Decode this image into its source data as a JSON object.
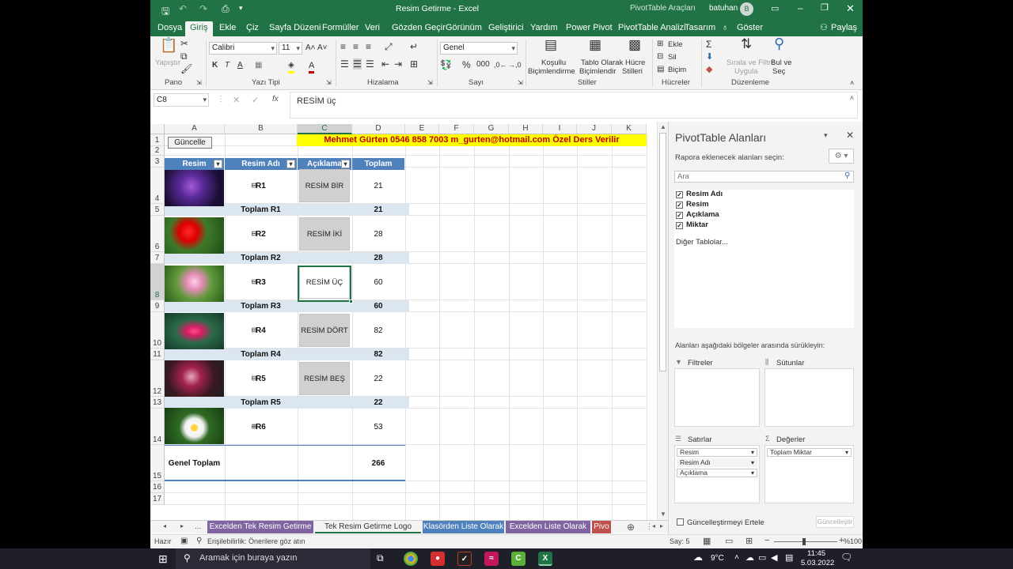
{
  "titlebar": {
    "doc_title": "Resim Getirme  -  Excel",
    "context_tools": "PivotTable Araçları",
    "user": "batuhan",
    "avatar_letter": "B"
  },
  "ribbon_tabs": [
    "Dosya",
    "Giriş",
    "Ekle",
    "Çiz",
    "Sayfa Düzeni",
    "Formüller",
    "Veri",
    "Gözden Geçir",
    "Görünüm",
    "Geliştirici",
    "Yardım",
    "Power Pivot",
    "PivotTable Analizi",
    "Tasarım",
    "Göster"
  ],
  "share_label": "Paylaş",
  "ribbon": {
    "paste": "Yapıştır",
    "font_name": "Calibri",
    "font_size": "11",
    "number_format": "Genel",
    "conditional_format": [
      "Koşullu",
      "Biçimlendirme"
    ],
    "format_table": [
      "Tablo Olarak",
      "Biçimlendir"
    ],
    "cell_styles": [
      "Hücre",
      "Stilleri"
    ],
    "insert": "Ekle",
    "delete": "Sil",
    "format": "Biçim",
    "sort_filter": [
      "Sırala ve Filtre",
      "Uygula"
    ],
    "find_select": [
      "Bul ve",
      "Seç"
    ],
    "groups": [
      "Pano",
      "Yazı Tipi",
      "Hizalama",
      "Sayı",
      "Stiller",
      "Hücreler",
      "Düzenleme"
    ]
  },
  "formula_bar": {
    "name_box": "C8",
    "fx": "fx",
    "value": "RESİM üç"
  },
  "grid": {
    "columns": [
      "A",
      "B",
      "C",
      "D",
      "E",
      "F",
      "G",
      "H",
      "I",
      "J",
      "K"
    ],
    "rows": [
      "1",
      "2",
      "3",
      "4",
      "5",
      "6",
      "7",
      "8",
      "9",
      "10",
      "11",
      "12",
      "13",
      "14",
      "15",
      "16",
      "17"
    ],
    "update_button": "Güncelle",
    "banner": "Mehmet Gürten 0546 858 7003 m_gurten@hotmail.com  Özel Ders Verilir",
    "pivot_headers": [
      "Resim",
      "Resim Adı",
      "Açıklama",
      "Toplam Miktar"
    ],
    "pivot_rows": [
      {
        "name": "R1",
        "desc": "RESİM BİR",
        "qty": "21",
        "total_label": "Toplam R1",
        "total": "21"
      },
      {
        "name": "R2",
        "desc": "RESİM İKİ",
        "qty": "28",
        "total_label": "Toplam R2",
        "total": "28"
      },
      {
        "name": "R3",
        "desc": "RESİM ÜÇ",
        "qty": "60",
        "total_label": "Toplam R3",
        "total": "60"
      },
      {
        "name": "R4",
        "desc": "RESİM DÖRT",
        "qty": "82",
        "total_label": "Toplam R4",
        "total": "82"
      },
      {
        "name": "R5",
        "desc": "RESİM BEŞ",
        "qty": "22",
        "total_label": "Toplam R5",
        "total": "22"
      },
      {
        "name": "R6",
        "desc": "",
        "qty": "53",
        "total_label": "",
        "total": ""
      }
    ],
    "grand_total_label": "Genel Toplam",
    "grand_total": "266"
  },
  "sheet_tabs": [
    {
      "label": "Excelden Tek Resim Getirme",
      "color": "#8064a2"
    },
    {
      "label": "Tek Resim Getirme Logo",
      "color": "#f3f3f3"
    },
    {
      "label": "Klasörden Liste Olarak",
      "color": "#4f81bd"
    },
    {
      "label": "Excelden Liste Olarak",
      "color": "#8064a2"
    },
    {
      "label": "Pivo",
      "color": "#c0504d"
    }
  ],
  "sheet_nav_ellipsis": "...",
  "statusbar": {
    "ready": "Hazır",
    "accessibility": "Erişilebilirlik: Önerilere göz atın",
    "count": "Say: 5",
    "zoom": "%100"
  },
  "pivot_pane": {
    "title": "PivotTable Alanları",
    "subtitle": "Rapora eklenecek alanları seçin:",
    "search_placeholder": "Ara",
    "fields": [
      "Resim Adı",
      "Resim",
      "Açıklama",
      "Miktar"
    ],
    "more_tables": "Diğer Tablolar...",
    "drag_hint": "Alanları aşağıdaki bölgeler arasında sürükleyin:",
    "zones": {
      "filters": "Filtreler",
      "columns": "Sütunlar",
      "rows": "Satırlar",
      "values": "Değerler"
    },
    "row_items": [
      "Resim",
      "Resim Adı",
      "Açıklama"
    ],
    "value_items": [
      "Toplam Miktar"
    ],
    "defer_update": "Güncelleştirmeyi Ertele",
    "update_button": "Güncelleştir"
  },
  "taskbar": {
    "search_placeholder": "Aramak için buraya yazın",
    "weather": "9°C",
    "time": "11:45",
    "date": "5.03.2022"
  }
}
